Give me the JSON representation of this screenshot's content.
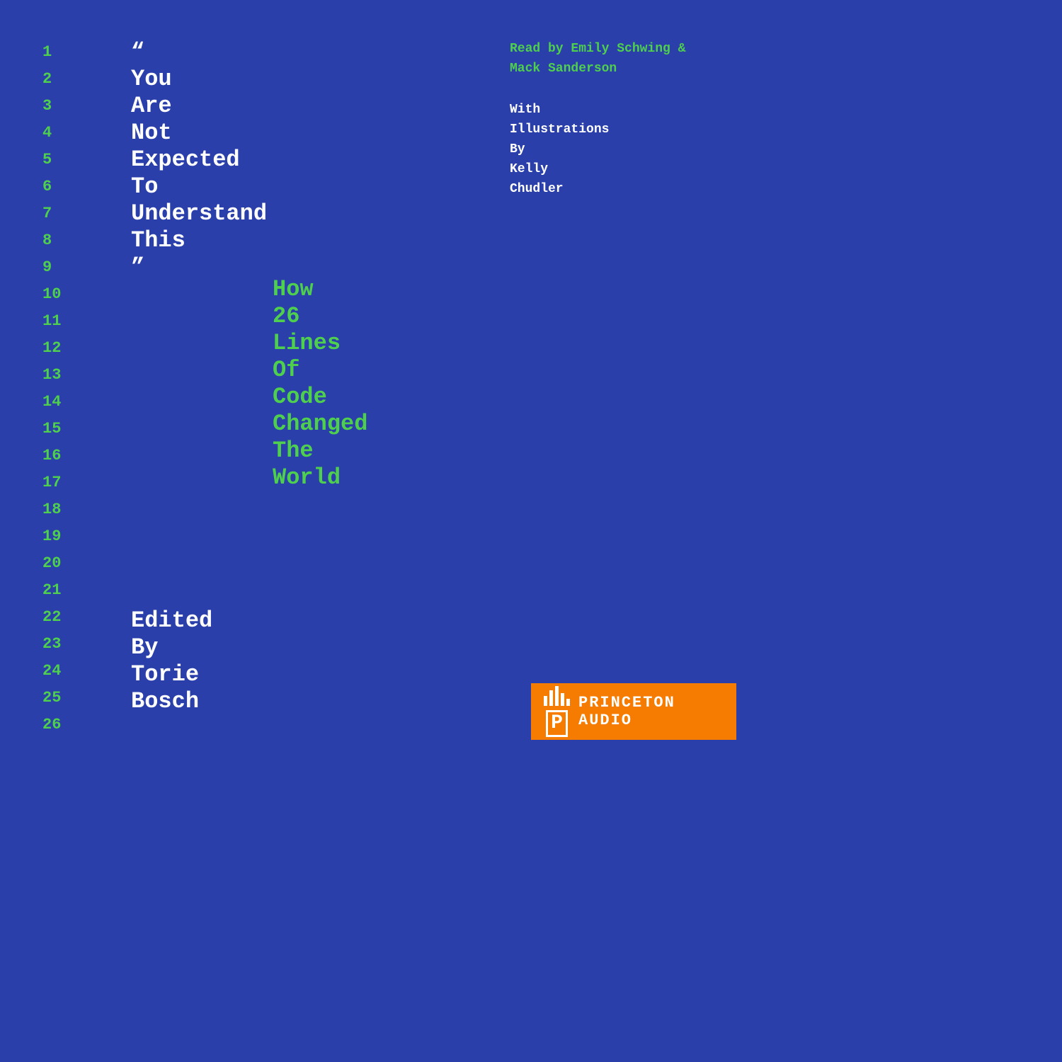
{
  "background_color": "#2a3faa",
  "line_numbers": [
    "1",
    "2",
    "3",
    "4",
    "5",
    "6",
    "7",
    "8",
    "9",
    "10",
    "11",
    "12",
    "13",
    "14",
    "15",
    "16",
    "17",
    "18",
    "19",
    "20",
    "21",
    "22",
    "23",
    "24",
    "25",
    "26"
  ],
  "quote": {
    "open_mark": "“",
    "words": [
      "You",
      "Are",
      "Not",
      "Expected",
      "To",
      "Understand",
      "This"
    ],
    "close_mark": "”"
  },
  "subtitle": {
    "words": [
      "How",
      "26",
      "Lines",
      "Of",
      "Code",
      "Changed",
      "The",
      "World"
    ]
  },
  "read_by": {
    "label": "Read by Emily Schwing &",
    "name": "Mack Sanderson"
  },
  "illustrations": {
    "line1": "With",
    "line2": "Illustrations",
    "line3": "By",
    "line4": "Kelly",
    "line5": "Chudler"
  },
  "edited": {
    "words": [
      "Edited",
      "By",
      "Torie",
      "Bosch"
    ]
  },
  "princeton": {
    "name": "PRINCETON",
    "audio": "AUDIO"
  }
}
